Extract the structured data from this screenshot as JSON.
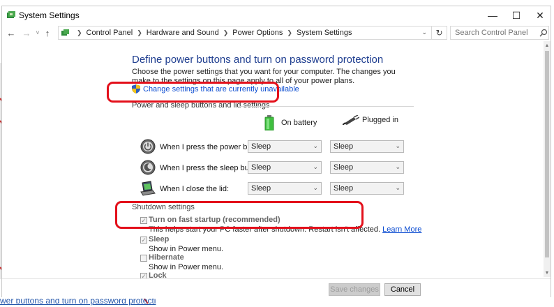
{
  "window": {
    "title": "System Settings",
    "minimize_glyph": "—",
    "maximize_glyph": "☐",
    "close_glyph": "✕"
  },
  "nav": {
    "back_glyph": "←",
    "forward_glyph": "→",
    "recent_glyph": "˅",
    "up_glyph": "↑",
    "refresh_glyph": "↻",
    "breadcrumb": [
      "Control Panel",
      "Hardware and Sound",
      "Power Options",
      "System Settings"
    ],
    "search_placeholder": "Search Control Panel"
  },
  "page": {
    "heading": "Define power buttons and turn on password protection",
    "description": "Choose the power settings that you want for your computer. The changes you make to the settings on this page apply to all of your power plans.",
    "change_link": "Change settings that are currently unavailable",
    "section_power": "Power and sleep buttons and lid settings",
    "columns": {
      "battery": "On battery",
      "plugged": "Plugged in"
    },
    "rows": [
      {
        "label": "When I press the power button:",
        "battery": "Sleep",
        "plugged": "Sleep",
        "icon": "power-button-icon"
      },
      {
        "label": "When I press the sleep button:",
        "battery": "Sleep",
        "plugged": "Sleep",
        "icon": "sleep-button-icon"
      },
      {
        "label": "When I close the lid:",
        "battery": "Sleep",
        "plugged": "Sleep",
        "icon": "laptop-lid-icon"
      }
    ],
    "section_shutdown": "Shutdown settings",
    "options": [
      {
        "title": "Turn on fast startup (recommended)",
        "desc": "This helps start your PC faster after shutdown. Restart isn't affected.",
        "checked": true
      },
      {
        "title": "Sleep",
        "desc": "Show in Power menu.",
        "checked": true
      },
      {
        "title": "Hibernate",
        "desc": "Show in Power menu.",
        "checked": false
      },
      {
        "title": "Lock",
        "desc": "",
        "checked": true
      }
    ],
    "learn_more": "Learn More"
  },
  "footer": {
    "save": "Save changes",
    "cancel": "Cancel"
  },
  "background": {
    "bottom_text": "wer buttons and turn on password protecti"
  },
  "colors": {
    "heading": "#1e3d8f",
    "link": "#0a4bd1",
    "highlight": "#e3101b",
    "battery_green": "#3fbf3f"
  }
}
